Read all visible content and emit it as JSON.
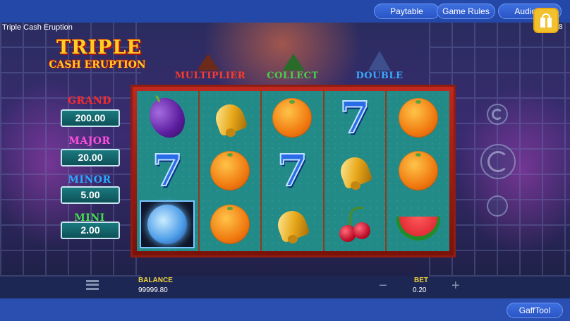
{
  "topbar": {
    "paytable_label": "Paytable",
    "rules_label": "Game Rules",
    "audio_label": "Audio O",
    "behind_text": "8"
  },
  "game": {
    "title": "Triple Cash Eruption",
    "logo_line1": "TRIPLE",
    "logo_line2": "CASH ERUPTION"
  },
  "jackpots": [
    {
      "label": "GRAND",
      "value": "200.00",
      "color": "#ff2a2a"
    },
    {
      "label": "MAJOR",
      "value": "20.00",
      "color": "#ff4fe0"
    },
    {
      "label": "MINOR",
      "value": "5.00",
      "color": "#29a9ff"
    },
    {
      "label": "MINI",
      "value": "2.00",
      "color": "#42e04c"
    }
  ],
  "features": [
    {
      "label": "MULTIPLIER",
      "color": "#ff3b2a",
      "icon": "red-volcano-icon"
    },
    {
      "label": "COLLECT",
      "color": "#45d24a",
      "icon": "green-volcano-icon"
    },
    {
      "label": "DOUBLE",
      "color": "#3aa8ff",
      "icon": "blue-volcano-icon"
    }
  ],
  "reels": [
    [
      "plum",
      "seven",
      "moon"
    ],
    [
      "bell",
      "orange",
      "orange"
    ],
    [
      "orange",
      "seven",
      "bell"
    ],
    [
      "seven",
      "bell",
      "cherry"
    ],
    [
      "orange",
      "orange",
      "watermelon"
    ]
  ],
  "bottom": {
    "balance_label": "BALANCE",
    "balance_value": "99999.80",
    "bet_label": "BET",
    "bet_value": "0.20",
    "minus": "−",
    "plus": "+"
  },
  "footer": {
    "gafftool_label": "GaffTool"
  },
  "colors": {
    "topbar": "#2348a8",
    "button": "#2a55c4",
    "reel_bg": "#228a87",
    "frame": "#c0281e",
    "label_gold": "#f2d13a"
  }
}
